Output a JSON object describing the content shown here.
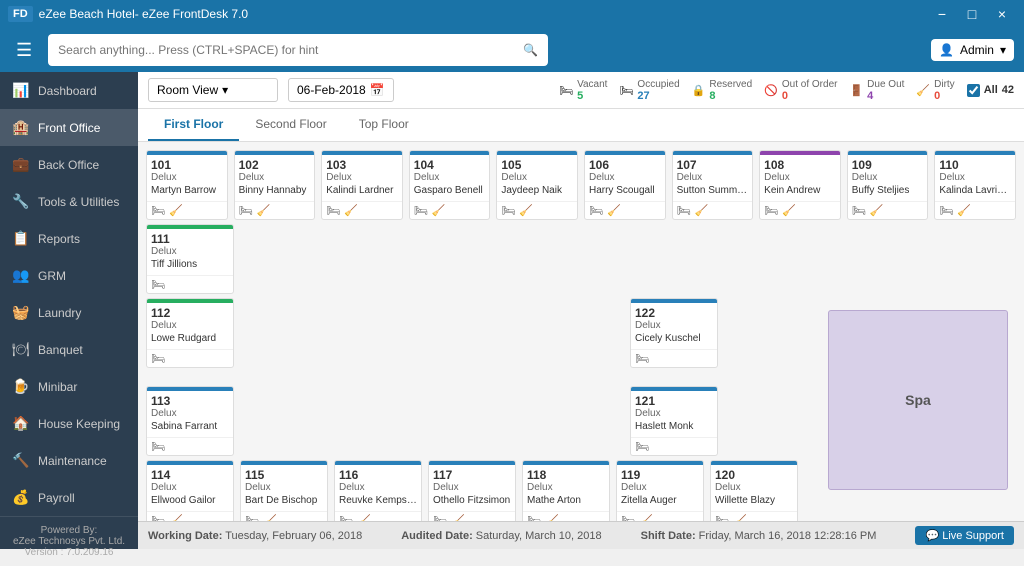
{
  "app": {
    "title": "eZee Beach Hotel- eZee FrontDesk 7.0",
    "version": "7.0.209.16"
  },
  "titlebar": {
    "minimize": "−",
    "restore": "□",
    "close": "×"
  },
  "topbar": {
    "search_placeholder": "Search anything... Press (CTRL+SPACE) for hint",
    "admin_label": "Admin"
  },
  "sidebar": {
    "items": [
      {
        "id": "dashboard",
        "label": "Dashboard",
        "icon": "📊",
        "active": false
      },
      {
        "id": "front-office",
        "label": "Front Office",
        "icon": "🏨",
        "active": true
      },
      {
        "id": "back-office",
        "label": "Back Office",
        "icon": "💼",
        "active": false
      },
      {
        "id": "tools",
        "label": "Tools & Utilities",
        "icon": "🔧",
        "active": false
      },
      {
        "id": "reports",
        "label": "Reports",
        "icon": "📋",
        "active": false
      },
      {
        "id": "grm",
        "label": "GRM",
        "icon": "👥",
        "active": false
      },
      {
        "id": "laundry",
        "label": "Laundry",
        "icon": "🧺",
        "active": false
      },
      {
        "id": "banquet",
        "label": "Banquet",
        "icon": "🍽",
        "active": false
      },
      {
        "id": "minibar",
        "label": "Minibar",
        "icon": "🍺",
        "active": false
      },
      {
        "id": "housekeeping",
        "label": "House Keeping",
        "icon": "🏠",
        "active": false
      },
      {
        "id": "maintenance",
        "label": "Maintenance",
        "icon": "🔨",
        "active": false
      },
      {
        "id": "payroll",
        "label": "Payroll",
        "icon": "💰",
        "active": false
      }
    ],
    "footer": {
      "powered_by": "Powered By:",
      "company": "eZee Technosys Pvt. Ltd.",
      "version_label": "Version : 7.0.209.16"
    }
  },
  "toolbar": {
    "view_label": "Room View",
    "date_value": "06-Feb-2018",
    "statuses": [
      {
        "id": "vacant",
        "label": "Vacant",
        "count": "5"
      },
      {
        "id": "occupied",
        "label": "Occupied",
        "count": "27"
      },
      {
        "id": "reserved",
        "label": "Reserved",
        "count": "8"
      },
      {
        "id": "out_of_order",
        "label": "Out of Order",
        "count": "0"
      },
      {
        "id": "due_out",
        "label": "Due Out",
        "count": "4"
      },
      {
        "id": "dirty",
        "label": "Dirty",
        "count": "0"
      },
      {
        "id": "all",
        "label": "All",
        "count": "42"
      }
    ]
  },
  "floor_tabs": [
    {
      "label": "First Floor",
      "active": true
    },
    {
      "label": "Second Floor",
      "active": false
    },
    {
      "label": "Top Floor",
      "active": false
    }
  ],
  "rooms": {
    "row1": [
      {
        "number": "101",
        "type": "Delux",
        "guest": "Martyn Barrow",
        "color": "blue"
      },
      {
        "number": "102",
        "type": "Delux",
        "guest": "Binny Hannaby",
        "color": "blue"
      },
      {
        "number": "103",
        "type": "Delux",
        "guest": "Kalindi Lardner",
        "color": "blue"
      },
      {
        "number": "104",
        "type": "Delux",
        "guest": "Gasparo Benell",
        "color": "blue"
      },
      {
        "number": "105",
        "type": "Delux",
        "guest": "Jaydeep Naik",
        "color": "blue"
      },
      {
        "number": "106",
        "type": "Delux",
        "guest": "Harry Scougall",
        "color": "blue"
      },
      {
        "number": "107",
        "type": "Delux",
        "guest": "Sutton Summerell",
        "color": "blue"
      },
      {
        "number": "108",
        "type": "Delux",
        "guest": "Kein Andrew",
        "color": "purple"
      },
      {
        "number": "109",
        "type": "Delux",
        "guest": "Buffy Steljies",
        "color": "blue"
      },
      {
        "number": "110",
        "type": "Delux",
        "guest": "Kalinda Lavrinov",
        "color": "blue"
      }
    ],
    "row2": [
      {
        "number": "111",
        "type": "Delux",
        "guest": "Tiff Jillions",
        "color": "green"
      }
    ],
    "row3": [
      {
        "number": "112",
        "type": "Delux",
        "guest": "Lowe Rudgard",
        "color": "green"
      }
    ],
    "row4": [
      {
        "number": "122",
        "type": "Delux",
        "guest": "Cicely Kuschel",
        "color": "blue"
      }
    ],
    "row5": [
      {
        "number": "113",
        "type": "Delux",
        "guest": "Sabina Farrant",
        "color": "blue"
      }
    ],
    "row6": [
      {
        "number": "121",
        "type": "Delux",
        "guest": "Haslett Monk",
        "color": "blue"
      }
    ],
    "row7": [
      {
        "number": "114",
        "type": "Delux",
        "guest": "Ellwood Gailor",
        "color": "blue"
      },
      {
        "number": "115",
        "type": "Delux",
        "guest": "Bart De Bischop",
        "color": "blue"
      },
      {
        "number": "116",
        "type": "Delux",
        "guest": "Reuvke Kempstone",
        "color": "blue"
      },
      {
        "number": "117",
        "type": "Delux",
        "guest": "Othello Fitzsimon",
        "color": "blue"
      },
      {
        "number": "118",
        "type": "Delux",
        "guest": "Mathe Arton",
        "color": "blue"
      },
      {
        "number": "119",
        "type": "Delux",
        "guest": "Zitella Auger",
        "color": "blue"
      },
      {
        "number": "120",
        "type": "Delux",
        "guest": "Willette Blazy",
        "color": "blue"
      }
    ]
  },
  "spa": {
    "label": "Spa"
  },
  "statusbar": {
    "working_date_label": "Working Date:",
    "working_date": "Tuesday, February 06, 2018",
    "audited_date_label": "Audited Date:",
    "audited_date": "Saturday, March 10, 2018",
    "shift_date_label": "Shift Date:",
    "shift_date": "Friday, March 16, 2018 12:28:16 PM",
    "live_support": "Live Support"
  }
}
